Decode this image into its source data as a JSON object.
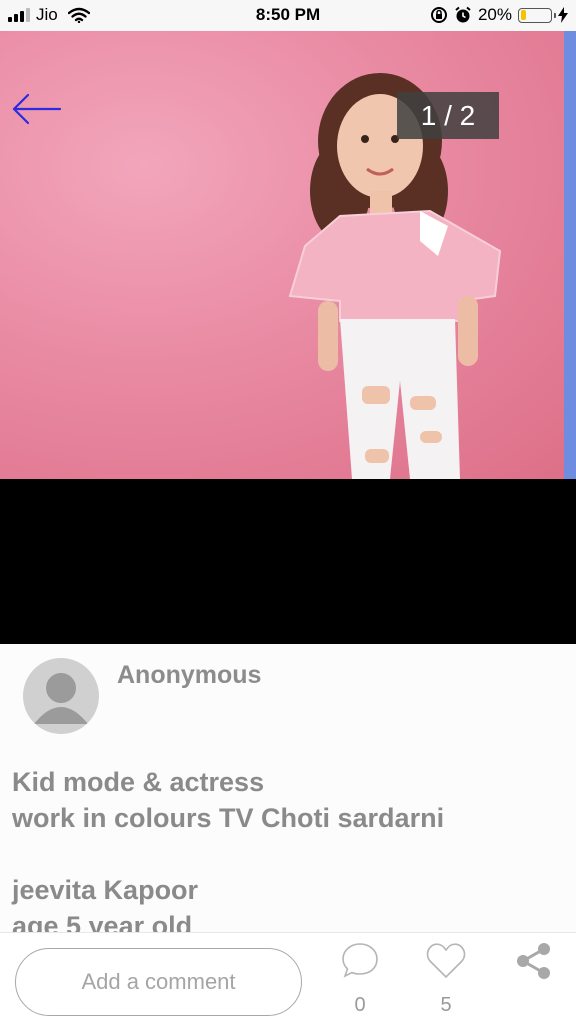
{
  "status_bar": {
    "carrier": "Jio",
    "time": "8:50 PM",
    "battery_percent": "20%",
    "battery_level": 0.2,
    "battery_color": "#f5c400"
  },
  "viewer": {
    "counter": "1 / 2",
    "back_icon": "arrow-left-icon",
    "accent_color": "#2b2be0"
  },
  "post": {
    "author": "Anonymous",
    "lines": [
      "Kid mode & actress",
      "work in colours TV Choti sardarni",
      "",
      "jeevita Kapoor",
      "age 5 year old"
    ]
  },
  "actions": {
    "comment_placeholder": "Add a comment",
    "comment_count": "0",
    "like_count": "5",
    "icons": [
      "comment-bubble-icon",
      "heart-icon",
      "share-icon"
    ]
  }
}
